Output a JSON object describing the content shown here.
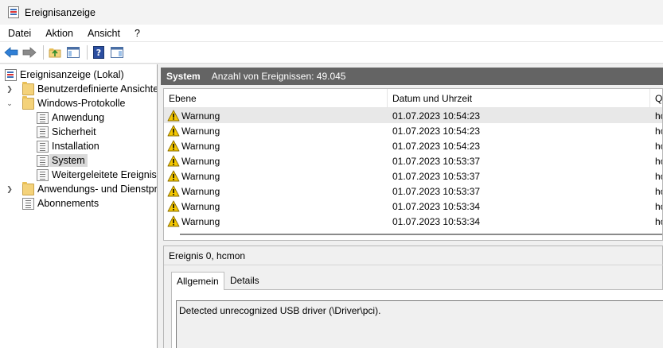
{
  "window": {
    "title": "Ereignisanzeige"
  },
  "menu": [
    "Datei",
    "Aktion",
    "Ansicht",
    "?"
  ],
  "toolbar": [
    "back-icon",
    "forward-icon",
    "folder-up-icon",
    "show-hide-tree-icon",
    "help-icon",
    "show-hide-action-pane-icon"
  ],
  "tree": {
    "root": "Ereignisanzeige (Lokal)",
    "custom_views": "Benutzerdefinierte Ansichten",
    "windows_logs": "Windows-Protokolle",
    "logs": [
      "Anwendung",
      "Sicherheit",
      "Installation",
      "System",
      "Weitergeleitete Ereignisse"
    ],
    "app_services": "Anwendungs- und Dienstprotokolle",
    "subscriptions": "Abonnements"
  },
  "log_header": {
    "title": "System",
    "count": "Anzahl von Ereignissen: 49.045"
  },
  "columns": {
    "level": "Ebene",
    "datetime": "Datum und Uhrzeit",
    "source": "Quelle"
  },
  "events": [
    {
      "level": "Warnung",
      "datetime": "01.07.2023 10:54:23",
      "source": "hcmon"
    },
    {
      "level": "Warnung",
      "datetime": "01.07.2023 10:54:23",
      "source": "hcmon"
    },
    {
      "level": "Warnung",
      "datetime": "01.07.2023 10:54:23",
      "source": "hcmon"
    },
    {
      "level": "Warnung",
      "datetime": "01.07.2023 10:53:37",
      "source": "hcmon"
    },
    {
      "level": "Warnung",
      "datetime": "01.07.2023 10:53:37",
      "source": "hcmon"
    },
    {
      "level": "Warnung",
      "datetime": "01.07.2023 10:53:37",
      "source": "hcmon"
    },
    {
      "level": "Warnung",
      "datetime": "01.07.2023 10:53:34",
      "source": "hcmon"
    },
    {
      "level": "Warnung",
      "datetime": "01.07.2023 10:53:34",
      "source": "hcmon"
    }
  ],
  "detail": {
    "title": "Ereignis 0, hcmon",
    "tabs": [
      "Allgemein",
      "Details"
    ],
    "description": "Detected unrecognized USB driver (\\Driver\\pci)."
  }
}
